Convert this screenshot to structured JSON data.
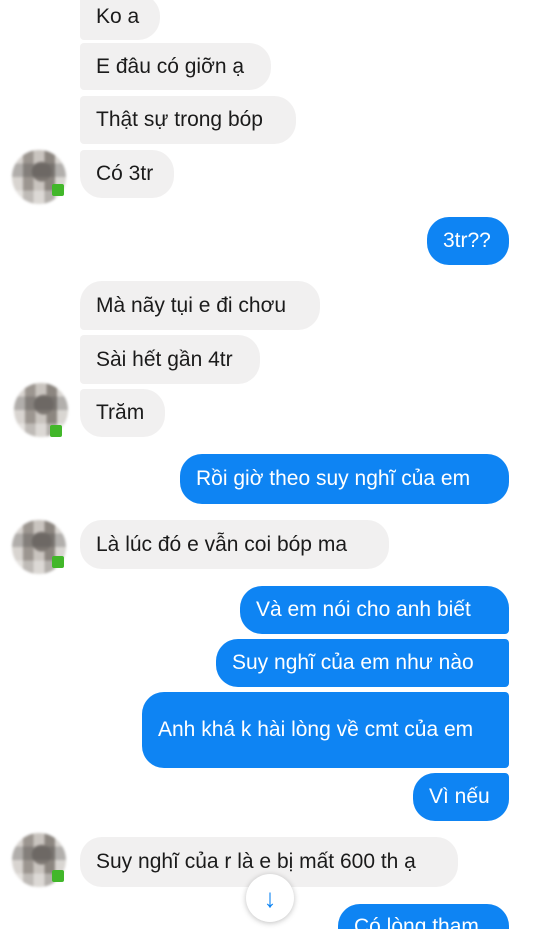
{
  "messages": {
    "m1": "Ko a",
    "m2": "E đâu có giỡn ạ",
    "m3": "Thật sự trong bóp",
    "m4": "Có 3tr",
    "m5": "3tr??",
    "m6": "Mà nãy tụi e đi chơu",
    "m7": "Sài hết gần 4tr",
    "m8": "Trăm",
    "m9": "Rồi giờ theo suy nghĩ của em",
    "m10": "Là lúc đó e vẫn coi bóp ma",
    "m11": "Và em nói cho anh biết",
    "m12": "Suy nghĩ của em như nào",
    "m13": "Anh khá k hài lòng về cmt của em",
    "m14": "Vì nếu",
    "m15": "Suy nghĩ của r là e bị mất 600 th ạ",
    "m16": "Có lòng tham"
  },
  "icons": {
    "scroll_down": "arrow-down-icon",
    "scroll_down_glyph": "↓"
  },
  "colors": {
    "outgoing_bubble": "#0e84f3",
    "incoming_bubble": "#f1f0f0",
    "online_indicator": "#42b72a"
  }
}
